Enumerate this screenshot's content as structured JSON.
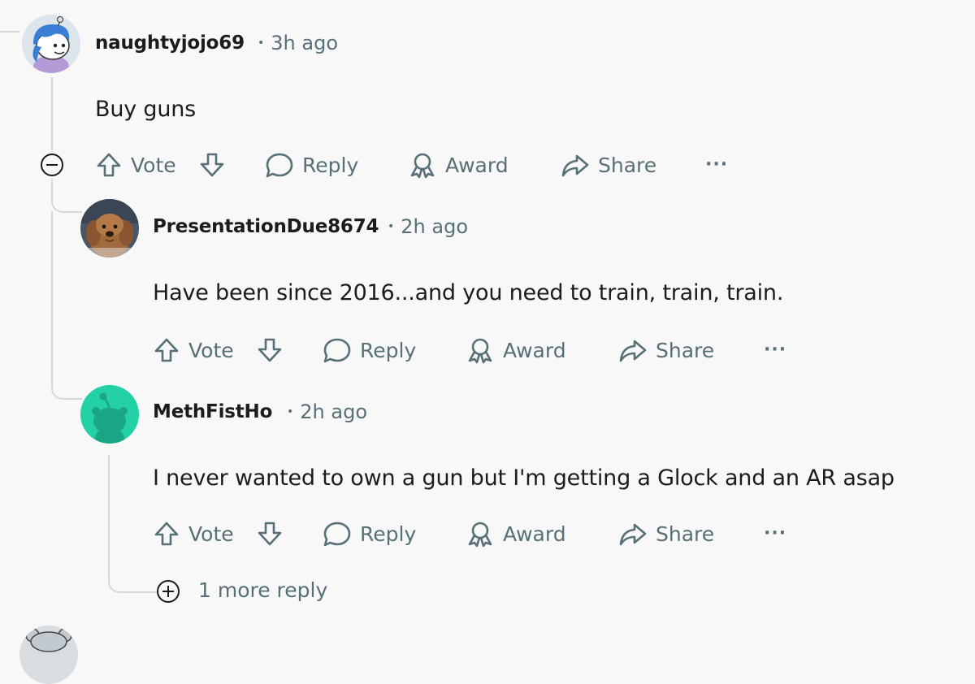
{
  "comments": [
    {
      "username": "naughtyjojo69",
      "time": "3h ago",
      "body": "Buy guns",
      "avatar_icon": "snoo-blue-hair-avatar"
    },
    {
      "username": "PresentationDue8674",
      "time": "2h ago",
      "body": "Have been since 2016...and you need to train, train, train.",
      "avatar_icon": "dog-photo-avatar"
    },
    {
      "username": "MethFistHo",
      "time": "2h ago",
      "body": "I never wanted to own a gun but I'm getting a Glock and an AR asap",
      "avatar_icon": "default-snoo-avatar"
    }
  ],
  "actions": {
    "vote": "Vote",
    "reply": "Reply",
    "award": "Award",
    "share": "Share",
    "more": "···"
  },
  "more_replies": "1 more reply",
  "colors": {
    "background": "#f8f8f8",
    "text": "#1c1c1c",
    "muted": "#576f76",
    "thread_line": "#d3d8dc",
    "avatar_teal": "#24d1a7"
  }
}
